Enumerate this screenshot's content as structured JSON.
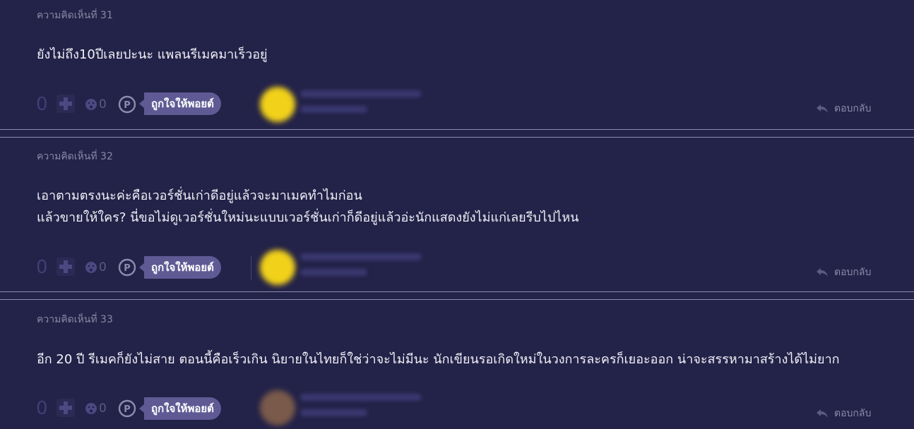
{
  "comments": [
    {
      "number_label": "ความคิดเห็นที่ 31",
      "lines": [
        "ยังไม่ถึง10ปีเลยปะนะ แพลนรีเมคมาเร็วอยู่"
      ],
      "vote_count": "0",
      "emotion_count": "0",
      "like_point_label": "ถูกใจให้พอยต์",
      "reply_label": "ตอบกลับ",
      "avatar_color": "#f2d11a"
    },
    {
      "number_label": "ความคิดเห็นที่ 32",
      "lines": [
        "เอาตามตรงนะค่ะคือเวอร์ชั่นเก่าดีอยู่แล้วจะมาเมคทำไมก่อน",
        "แล้วขายให้ใคร? นี่ขอไม่ดูเวอร์ชั่นใหม่นะแบบเวอร์ชั่นเก่าก็ดีอยู่แล้วอ่ะนักแสดงยังไม่แก่เลยรีบไปไหน"
      ],
      "vote_count": "0",
      "emotion_count": "0",
      "like_point_label": "ถูกใจให้พอยต์",
      "reply_label": "ตอบกลับ",
      "avatar_color": "#f2d11a"
    },
    {
      "number_label": "ความคิดเห็นที่ 33",
      "lines": [
        "อีก 20 ปี รีเมคก็ยังไม่สาย ตอนนี้คือเร็วเกิน นิยายในไทยก็ใช่ว่าจะไม่มีนะ นักเขียนรอเกิดใหม่ในวงการละครก็เยอะออก น่าจะสรรหามาสร้างได้ไม่ยาก"
      ],
      "vote_count": "0",
      "emotion_count": "0",
      "like_point_label": "ถูกใจให้พอยต์",
      "reply_label": "ตอบกลับ",
      "avatar_color": "#7a5a4a"
    }
  ],
  "colors": {
    "background": "#232248",
    "pill": "#5f5a94",
    "separator": "#8e8cb0"
  },
  "icons": [
    "plus-icon",
    "emotion-face-icon",
    "point-p-icon",
    "reply-arrow-icon"
  ]
}
